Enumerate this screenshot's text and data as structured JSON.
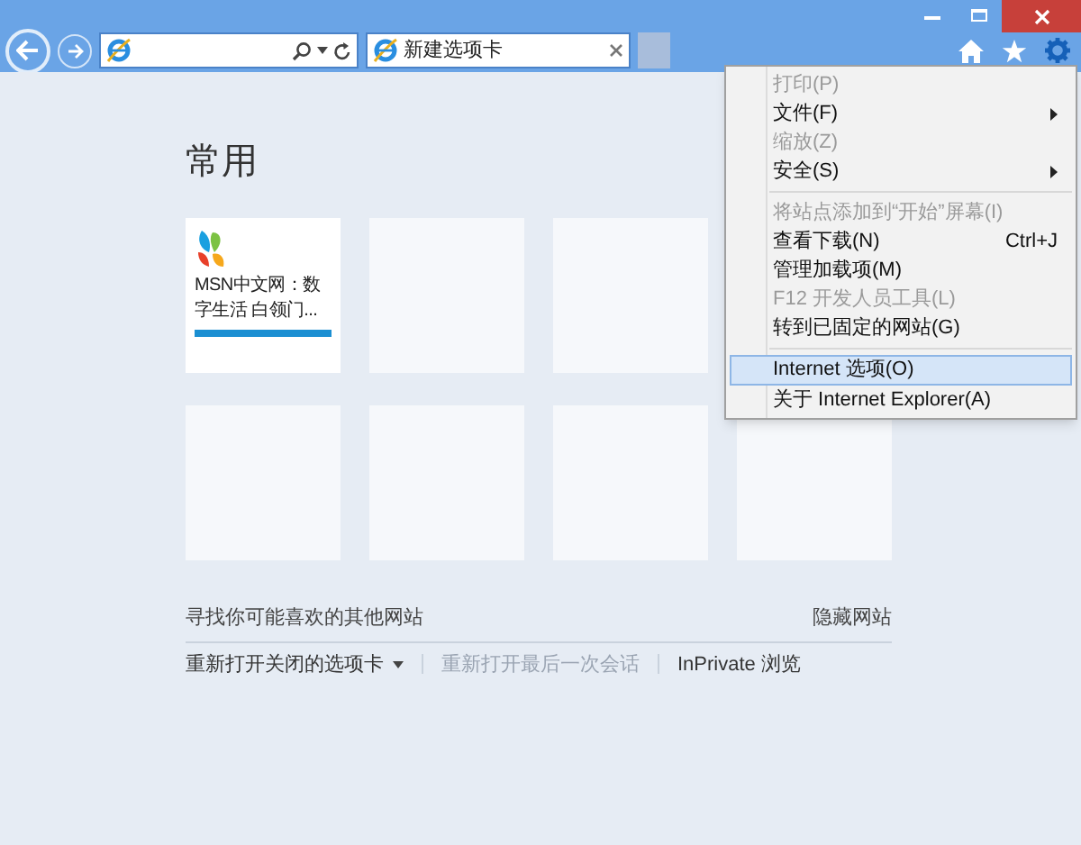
{
  "tabs": [
    {
      "label": "新建选项卡",
      "selected": true
    }
  ],
  "heading": "常用",
  "tile_rows": [
    [
      {
        "kind": "site",
        "title": "MSN中文网：数字生活 白领门..."
      },
      {
        "kind": "empty"
      },
      {
        "kind": "empty"
      }
    ],
    [
      {
        "kind": "empty"
      },
      {
        "kind": "empty"
      },
      {
        "kind": "empty"
      },
      {
        "kind": "empty"
      }
    ]
  ],
  "footer": {
    "discover": "寻找你可能喜欢的其他网站",
    "hide": "隐藏网站",
    "links": [
      {
        "label": "重新打开关闭的选项卡",
        "disabled": false,
        "dropdown": true
      },
      {
        "label": "重新打开最后一次会话",
        "disabled": true,
        "dropdown": false
      },
      {
        "label": "InPrivate 浏览",
        "disabled": false,
        "dropdown": false
      }
    ]
  },
  "menu": [
    {
      "kind": "item",
      "label": "打印(P)",
      "disabled": true,
      "submenu": false,
      "selected": false
    },
    {
      "kind": "item",
      "label": "文件(F)",
      "disabled": false,
      "submenu": true,
      "selected": false
    },
    {
      "kind": "item",
      "label": "缩放(Z)",
      "disabled": true,
      "submenu": false,
      "selected": false
    },
    {
      "kind": "item",
      "label": "安全(S)",
      "disabled": false,
      "submenu": true,
      "selected": false
    },
    {
      "kind": "separator"
    },
    {
      "kind": "item",
      "label": "将站点添加到“开始”屏幕(I)",
      "disabled": true,
      "submenu": false,
      "selected": false
    },
    {
      "kind": "item",
      "label": "查看下载(N)",
      "shortcut": "Ctrl+J",
      "disabled": false,
      "submenu": false,
      "selected": false
    },
    {
      "kind": "item",
      "label": "管理加载项(M)",
      "disabled": false,
      "submenu": false,
      "selected": false
    },
    {
      "kind": "item",
      "label": "F12 开发人员工具(L)",
      "disabled": true,
      "submenu": false,
      "selected": false
    },
    {
      "kind": "item",
      "label": "转到已固定的网站(G)",
      "disabled": false,
      "submenu": false,
      "selected": false
    },
    {
      "kind": "separator"
    },
    {
      "kind": "item",
      "label": "Internet 选项(O)",
      "disabled": false,
      "submenu": false,
      "selected": true
    },
    {
      "kind": "item",
      "label": "关于 Internet Explorer(A)",
      "disabled": false,
      "submenu": false,
      "selected": false
    }
  ]
}
